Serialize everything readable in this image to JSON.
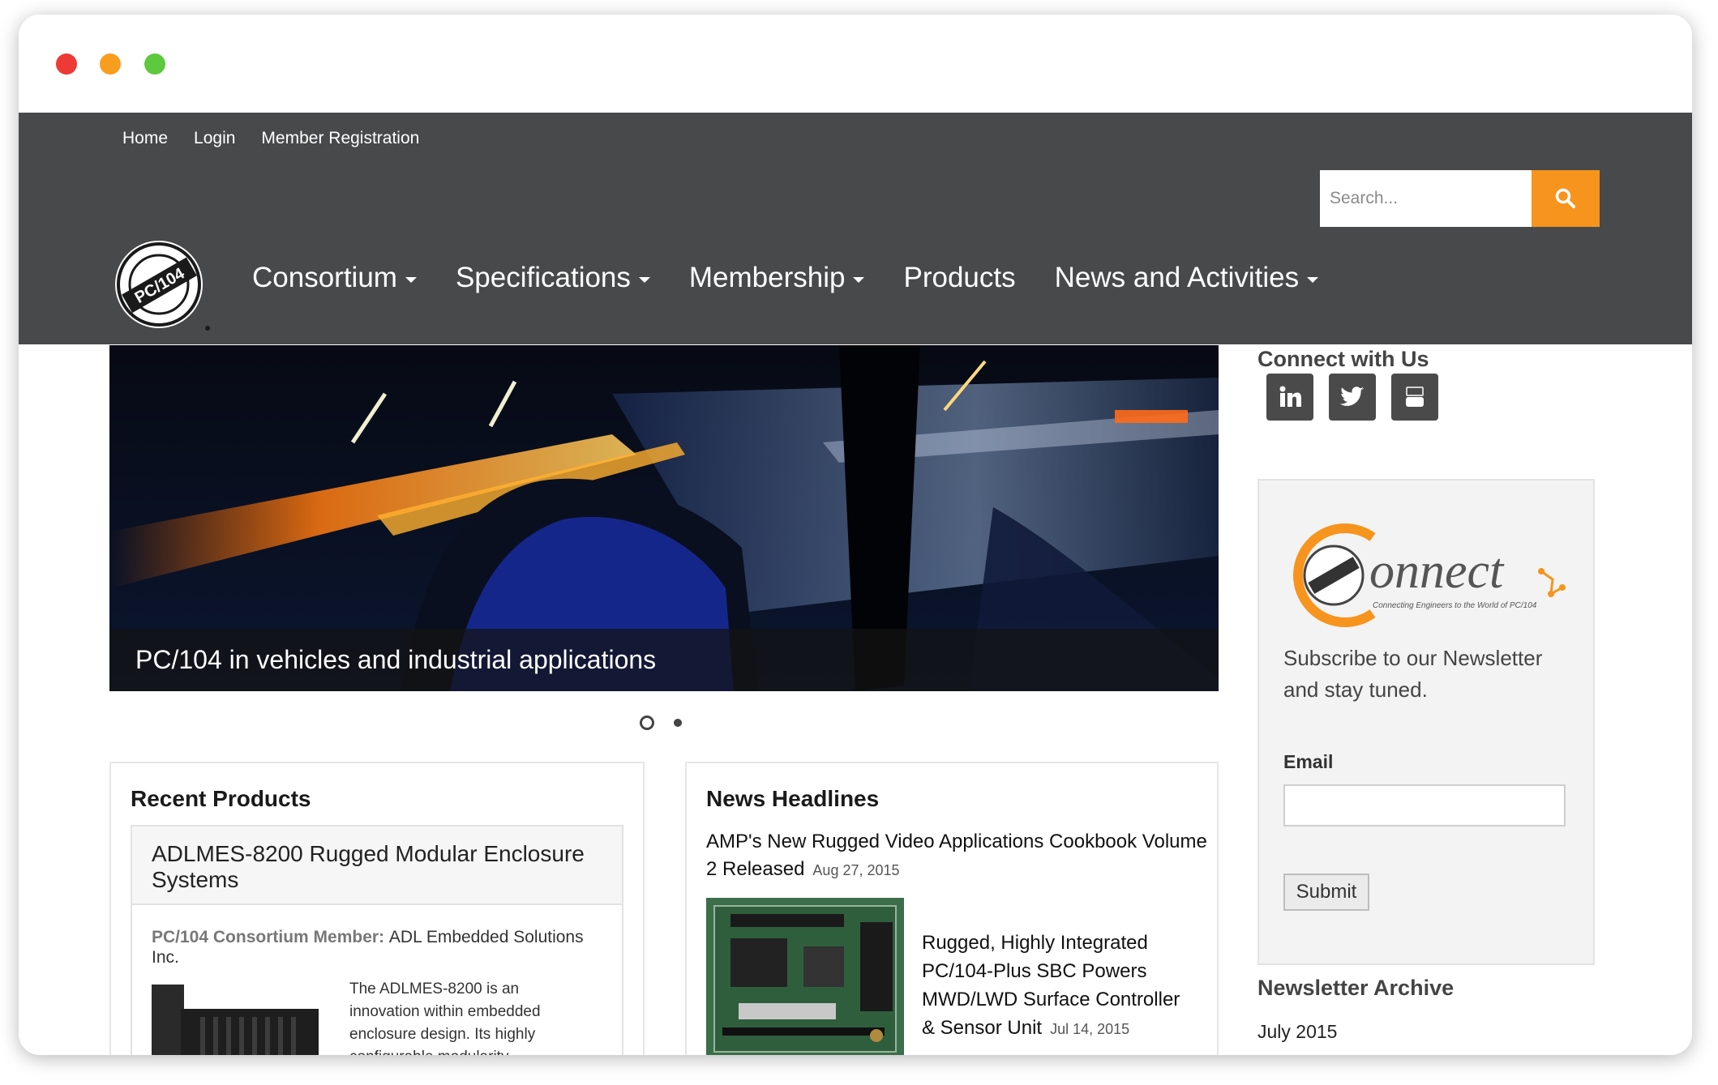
{
  "window": {
    "controls": [
      "close",
      "minimize",
      "maximize"
    ]
  },
  "topnav": {
    "home": "Home",
    "login": "Login",
    "register": "Member Registration"
  },
  "search": {
    "placeholder": "Search...",
    "icon": "search-icon"
  },
  "logo": {
    "alt": "PC/104 Embedded-PC Modules"
  },
  "mainnav": {
    "consortium": "Consortium",
    "specifications": "Specifications",
    "membership": "Membership",
    "products": "Products",
    "news": "News and Activities"
  },
  "hero": {
    "caption": "PC/104 in vehicles and industrial applications",
    "slides": 2,
    "active_slide": 1
  },
  "recent_products": {
    "heading": "Recent Products",
    "product_title": "ADLMES-8200 Rugged Modular Enclosure Systems",
    "member_label": "PC/104 Consortium Member:",
    "member_value": "ADL Embedded Solutions",
    "member_suffix": "Inc.",
    "description": "The ADLMES-8200 is an innovation within embedded enclosure design. Its highly configurable modularity"
  },
  "news": {
    "heading": "News Headlines",
    "items": [
      {
        "title": "AMP's New Rugged Video Applications Cookbook Volume 2 Released",
        "date": "Aug 27, 2015"
      },
      {
        "title": "Rugged, Highly Integrated PC/104-Plus SBC Powers MWD/LWD Surface Controller & Sensor Unit",
        "date": "Jul 14, 2015"
      }
    ]
  },
  "sidebar": {
    "connect_heading": "Connect with Us",
    "social": [
      "linkedin-icon",
      "twitter-icon",
      "youtube-icon"
    ],
    "newsletter": {
      "brand": "onnect",
      "tagline": "Connecting Engineers to the World of PC/104",
      "text": "Subscribe to our Newsletter and stay tuned.",
      "email_label": "Email",
      "submit": "Submit"
    },
    "archive_heading": "Newsletter Archive",
    "archive_items": [
      "July 2015"
    ]
  },
  "colors": {
    "header": "#48494b",
    "accent": "#f7941d"
  }
}
